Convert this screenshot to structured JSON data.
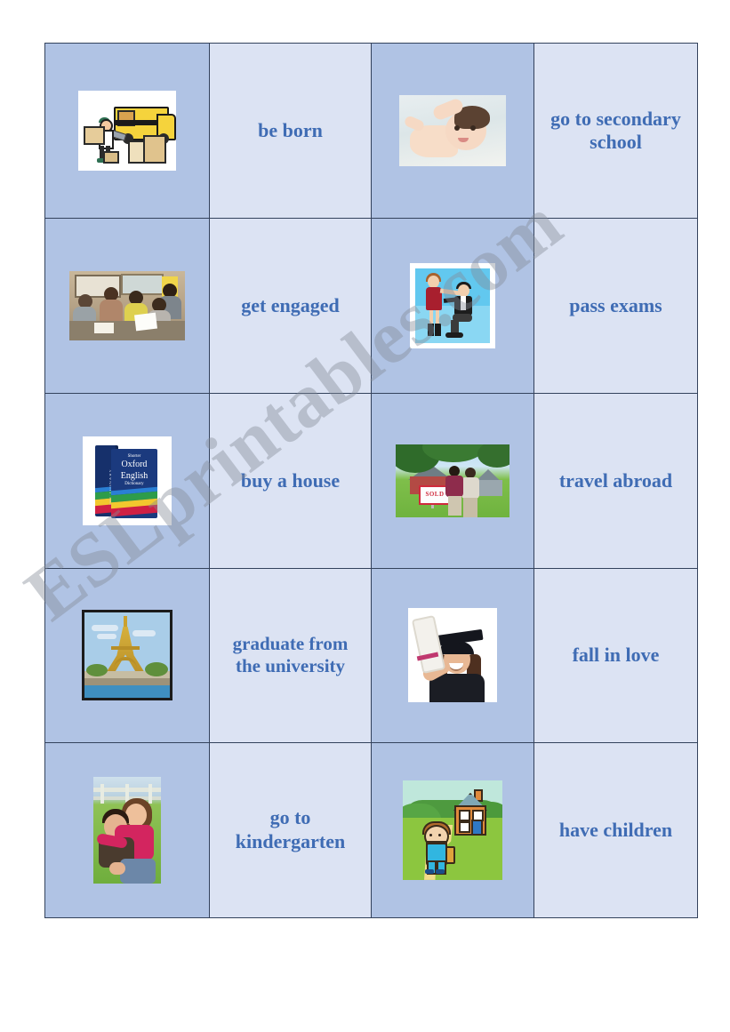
{
  "document": {
    "type": "esl-vocabulary-matching-worksheet",
    "watermark": "ESLprintables.com",
    "text_color": "#3f6cb4",
    "image_cell_color": "#b0c3e4",
    "text_cell_color": "#dce3f3",
    "border_color": "#33425c"
  },
  "table": {
    "columns": 4,
    "rows": 5,
    "cells": [
      {
        "row": 1,
        "image_left": {
          "name": "moving-truck-illustration",
          "alt": "Man loading boxes into a yellow moving truck"
        },
        "phrase_left": "be born",
        "image_right": {
          "name": "newborn-baby-photo",
          "alt": "Newborn baby lying down with arm raised"
        },
        "phrase_right": "go to secondary school"
      },
      {
        "row": 2,
        "image_left": {
          "name": "classroom-students-photo",
          "alt": "Students working at desks in a classroom"
        },
        "phrase_left": "get engaged",
        "image_right": {
          "name": "marriage-proposal-illustration",
          "alt": "Man kneeling proposing to woman in red dress"
        },
        "phrase_right": "pass exams"
      },
      {
        "row": 3,
        "image_left": {
          "name": "oxford-dictionary-books-photo",
          "alt": "Two Shorter Oxford English Dictionary volumes"
        },
        "phrase_left": "buy a house",
        "image_right": {
          "name": "couple-buying-house-photo",
          "alt": "Couple standing in front of a house with a SOLD sign"
        },
        "phrase_right": "travel abroad"
      },
      {
        "row": 4,
        "image_left": {
          "name": "eiffel-tower-illustration",
          "alt": "Eiffel Tower over the Seine in Paris"
        },
        "phrase_left": "graduate from the university",
        "image_right": {
          "name": "graduate-with-diploma-photo",
          "alt": "Smiling graduate in cap and gown holding a diploma"
        },
        "phrase_right": "fall in love"
      },
      {
        "row": 5,
        "image_left": {
          "name": "couple-piggyback-photo",
          "alt": "Woman riding piggyback on a man outdoors"
        },
        "phrase_left": "go to kindergarten",
        "image_right": {
          "name": "boy-walking-home-illustration",
          "alt": "Cartoon boy walking on a path to a house"
        },
        "phrase_right": "have children"
      }
    ]
  },
  "book_labels": {
    "shorter": "Shorter",
    "oxford": "Oxford",
    "english": "English",
    "dictionary": "Dictionary",
    "spine": "DICTIONARY"
  },
  "sign_label": "SOLD"
}
